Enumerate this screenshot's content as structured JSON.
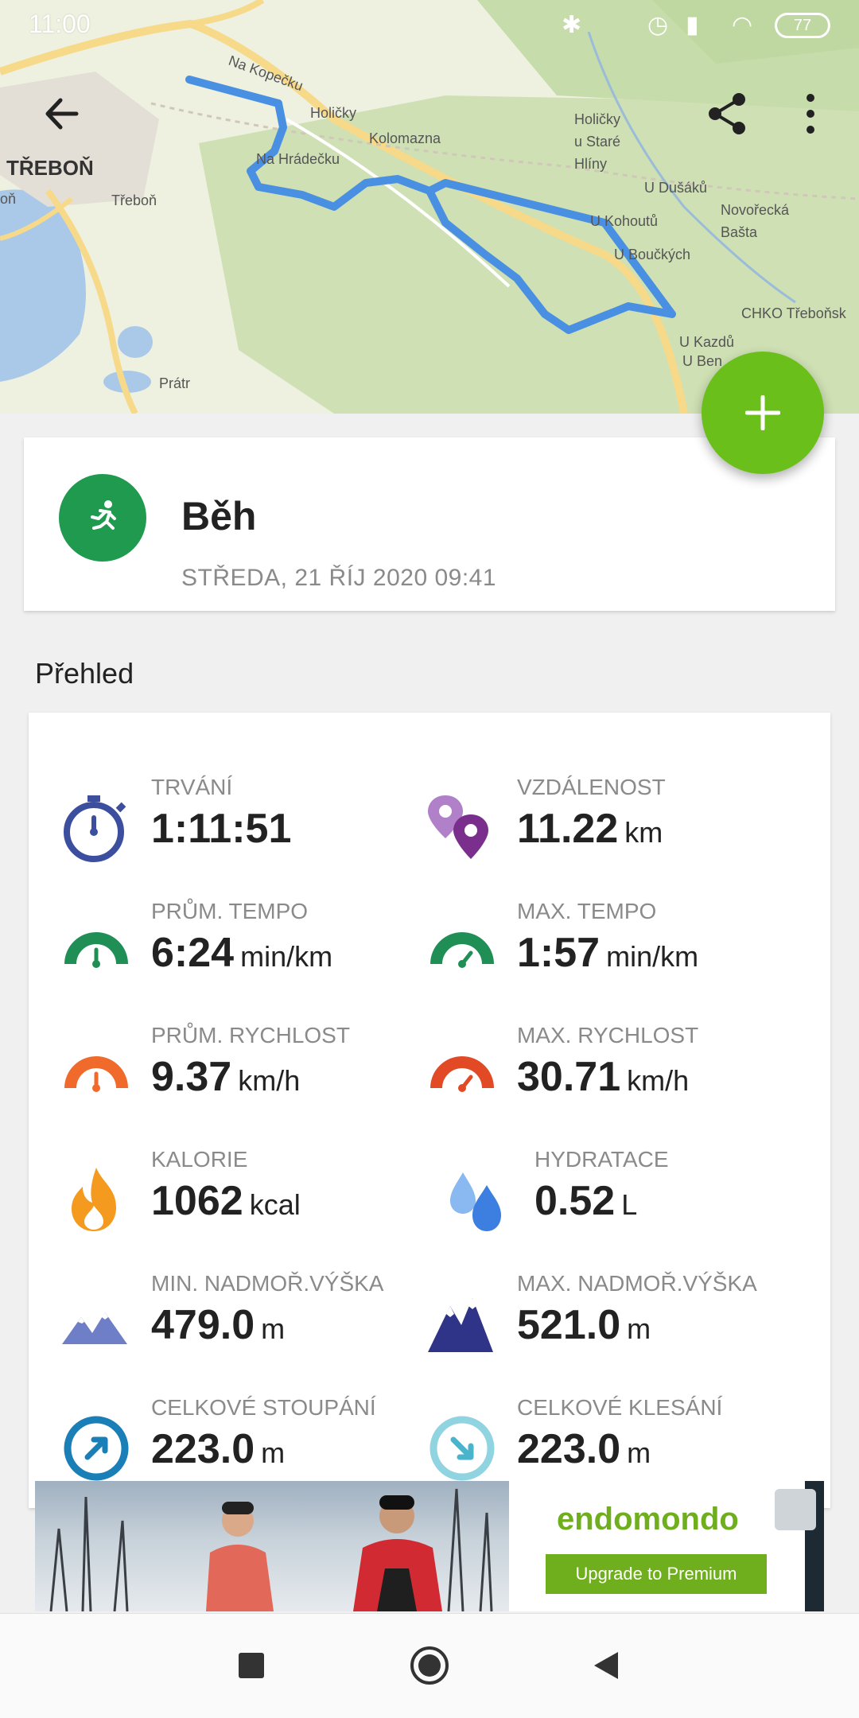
{
  "status_bar": {
    "time": "11:00",
    "battery": "77"
  },
  "map": {
    "labels": {
      "trebon_big": "TŘEBOŇ",
      "trebon": "Třeboň",
      "na_kopecku": "Na Kopečku",
      "holicky": "Holičky",
      "kolomazna": "Kolomazna",
      "na_hradecku": "Na Hrádečku",
      "holicky_ustare": "Holičky\nu Staré\nHlíny",
      "u_dusaku": "U Dušáků",
      "novorecka": "Novořecká\nBašta",
      "u_kohoutu": "U Kohoutů",
      "u_bouckych": "U Boučkých",
      "chko": "CHKO Třeboňsk",
      "u_kazdu": "U Kazdů",
      "u_ben": "U Ben",
      "pratr": "Prátr",
      "on": "oň"
    }
  },
  "toolbar": {
    "back_icon": "arrow-left-icon",
    "share_icon": "share-icon",
    "more_icon": "more-vert-icon"
  },
  "fab": {
    "icon": "plus-icon",
    "color": "#6bbf1a"
  },
  "workout": {
    "title": "Běh",
    "date": "STŘEDA, 21 ŘÍJ 2020 09:41",
    "icon": "running-icon",
    "icon_color": "#1f9a4f"
  },
  "overview": {
    "title": "Přehled",
    "stats": [
      {
        "label": "TRVÁNÍ",
        "value": "1:11:51",
        "unit": "",
        "icon": "stopwatch-icon"
      },
      {
        "label": "VZDÁLENOST",
        "value": "11.22",
        "unit": "km",
        "icon": "map-pins-icon"
      },
      {
        "label": "PRŮM. TEMPO",
        "value": "6:24",
        "unit": "min/km",
        "icon": "gauge-green-icon"
      },
      {
        "label": "MAX. TEMPO",
        "value": "1:57",
        "unit": "min/km",
        "icon": "gauge-green-max-icon"
      },
      {
        "label": "PRŮM. RYCHLOST",
        "value": "9.37",
        "unit": "km/h",
        "icon": "gauge-orange-icon"
      },
      {
        "label": "MAX. RYCHLOST",
        "value": "30.71",
        "unit": "km/h",
        "icon": "gauge-red-icon"
      },
      {
        "label": "KALORIE",
        "value": "1062",
        "unit": "kcal",
        "icon": "flame-icon"
      },
      {
        "label": "HYDRATACE",
        "value": "0.52",
        "unit": "L",
        "icon": "water-drops-icon"
      },
      {
        "label": "MIN. NADMOŘ.VÝŠKA",
        "value": "479.0",
        "unit": "m",
        "icon": "mountain-light-icon"
      },
      {
        "label": "MAX. NADMOŘ.VÝŠKA",
        "value": "521.0",
        "unit": "m",
        "icon": "mountain-dark-icon"
      },
      {
        "label": "CELKOVÉ STOUPÁNÍ",
        "value": "223.0",
        "unit": "m",
        "icon": "ascent-icon"
      },
      {
        "label": "CELKOVÉ KLESÁNÍ",
        "value": "223.0",
        "unit": "m",
        "icon": "descent-icon"
      }
    ]
  },
  "ad": {
    "brand": "endomondo",
    "button": "Upgrade to Premium",
    "accent": "#6fae1d"
  },
  "navbar": {
    "recents_icon": "square-icon",
    "home_icon": "circle-icon",
    "back_icon": "triangle-back-icon"
  }
}
